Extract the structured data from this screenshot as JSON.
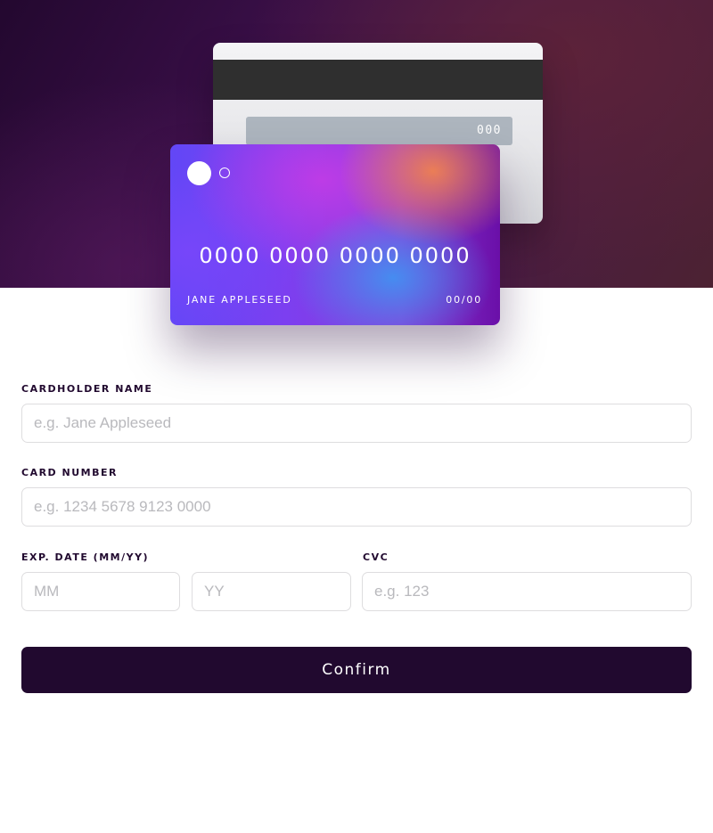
{
  "card_back": {
    "cvc": "000"
  },
  "card_front": {
    "number": "0000 0000 0000 0000",
    "holder": "JANE APPLESEED",
    "expiry": "00/00"
  },
  "form": {
    "name_label": "CARDHOLDER NAME",
    "name_placeholder": "e.g. Jane Appleseed",
    "number_label": "CARD NUMBER",
    "number_placeholder": "e.g. 1234 5678 9123 0000",
    "exp_label": "EXP. DATE (MM/YY)",
    "mm_placeholder": "MM",
    "yy_placeholder": "YY",
    "cvc_label": "CVC",
    "cvc_placeholder": "e.g. 123",
    "confirm_label": "Confirm"
  },
  "colors": {
    "primary": "#21092f",
    "input_border": "#dedddf",
    "placeholder": "#b9b9bd"
  }
}
